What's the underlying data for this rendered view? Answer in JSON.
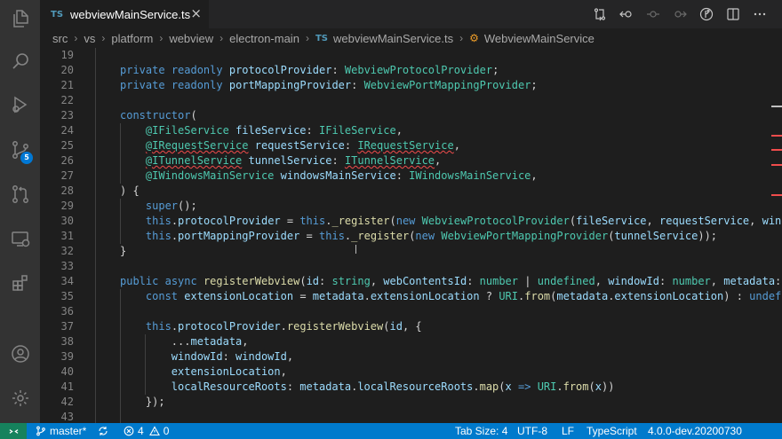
{
  "tab": {
    "language_badge": "TS",
    "file_name": "webviewMainService.ts",
    "close_glyph": "×"
  },
  "toolbar_icons": [
    "compare-changes-icon",
    "go-back-icon",
    "dot-icon",
    "go-forward-icon",
    "source-control-icon",
    "split-editor-icon",
    "more-actions-icon"
  ],
  "breadcrumb": {
    "parts": [
      "src",
      "vs",
      "platform",
      "webview",
      "electron-main"
    ],
    "file_badge": "TS",
    "file": "webviewMainService.ts",
    "symbol": "WebviewMainService"
  },
  "activity_bar": {
    "items": [
      "explorer",
      "search",
      "run-and-debug",
      "source-control",
      "pull-requests",
      "remote-explorer",
      "extensions",
      "accounts",
      "manage"
    ],
    "source_control_badge": "5"
  },
  "editor": {
    "lines": [
      {
        "n": "19",
        "indent": 1,
        "html": ""
      },
      {
        "n": "20",
        "indent": 1,
        "html": "<span class=\"kw\">private</span> <span class=\"kw\">readonly</span> <span class=\"va\">protocolProvider</span>: <span class=\"ty\">WebviewProtocolProvider</span>;"
      },
      {
        "n": "21",
        "indent": 1,
        "html": "<span class=\"kw\">private</span> <span class=\"kw\">readonly</span> <span class=\"va\">portMappingProvider</span>: <span class=\"ty\">WebviewPortMappingProvider</span>;"
      },
      {
        "n": "22",
        "indent": 1,
        "html": ""
      },
      {
        "n": "23",
        "indent": 1,
        "html": "<span class=\"kw\">constructor</span>("
      },
      {
        "n": "24",
        "indent": 2,
        "html": "    <span class=\"ty\">@IFileService</span> <span class=\"va\">fileService</span>: <span class=\"ty\">IFileService</span>,"
      },
      {
        "n": "25",
        "indent": 2,
        "html": "    <span class=\"ty squig\">@IRequestService</span> <span class=\"va\">requestService</span>: <span class=\"ty squig\">IRequestService</span>,"
      },
      {
        "n": "26",
        "indent": 2,
        "html": "    <span class=\"ty squig\">@ITunnelService</span> <span class=\"va\">tunnelService</span>: <span class=\"ty squig\">ITunnelService</span>,"
      },
      {
        "n": "27",
        "indent": 2,
        "html": "    <span class=\"ty\">@IWindowsMainService</span> <span class=\"va\">windowsMainService</span>: <span class=\"ty\">IWindowsMainService</span>,"
      },
      {
        "n": "28",
        "indent": 1,
        "html": ") {"
      },
      {
        "n": "29",
        "indent": 2,
        "html": "    <span class=\"kw\">super</span>();"
      },
      {
        "n": "30",
        "indent": 2,
        "html": "    <span class=\"kw\">this</span>.<span class=\"va\">protocolProvider</span> = <span class=\"kw\">this</span>.<span class=\"fn\">_register</span>(<span class=\"kw\">new</span> <span class=\"ty\">WebviewProtocolProvider</span>(<span class=\"va\">fileService</span>, <span class=\"va\">requestService</span>, <span class=\"va\">windowsMa</span>"
      },
      {
        "n": "31",
        "indent": 2,
        "html": "    <span class=\"kw\">this</span>.<span class=\"va\">portMappingProvider</span> = <span class=\"kw\">this</span>.<span class=\"fn\">_register</span>(<span class=\"kw\">new</span> <span class=\"ty\">WebviewPortMappingProvider</span>(<span class=\"va\">tunnelService</span>));"
      },
      {
        "n": "32",
        "indent": 1,
        "html": "}"
      },
      {
        "n": "33",
        "indent": 1,
        "html": ""
      },
      {
        "n": "34",
        "indent": 1,
        "html": "<span class=\"kw\">public</span> <span class=\"kw\">async</span> <span class=\"fn\">registerWebview</span>(<span class=\"va\">id</span>: <span class=\"ty\">string</span>, <span class=\"va\">webContentsId</span>: <span class=\"ty\">number</span> | <span class=\"ty\">undefined</span>, <span class=\"va\">windowId</span>: <span class=\"ty\">number</span>, <span class=\"va\">metadata</span>: <span class=\"ty\">Regis</span>"
      },
      {
        "n": "35",
        "indent": 2,
        "html": "    <span class=\"kw\">const</span> <span class=\"va\">extensionLocation</span> = <span class=\"va\">metadata</span>.<span class=\"va\">extensionLocation</span> ? <span class=\"ty\">URI</span>.<span class=\"fn\">from</span>(<span class=\"va\">metadata</span>.<span class=\"va\">extensionLocation</span>) : <span class=\"kw\">undefined</span>;"
      },
      {
        "n": "36",
        "indent": 2,
        "html": ""
      },
      {
        "n": "37",
        "indent": 2,
        "html": "    <span class=\"kw\">this</span>.<span class=\"va\">protocolProvider</span>.<span class=\"fn\">registerWebview</span>(<span class=\"va\">id</span>, {"
      },
      {
        "n": "38",
        "indent": 3,
        "html": "        ...<span class=\"va\">metadata</span>,"
      },
      {
        "n": "39",
        "indent": 3,
        "html": "        <span class=\"va\">windowId</span>: <span class=\"va\">windowId</span>,"
      },
      {
        "n": "40",
        "indent": 3,
        "html": "        <span class=\"va\">extensionLocation</span>,"
      },
      {
        "n": "41",
        "indent": 3,
        "html": "        <span class=\"va\">localResourceRoots</span>: <span class=\"va\">metadata</span>.<span class=\"va\">localResourceRoots</span>.<span class=\"fn\">map</span>(<span class=\"va\">x</span> <span class=\"kw\">=&gt;</span> <span class=\"ty\">URI</span>.<span class=\"fn\">from</span>(<span class=\"va\">x</span>))"
      },
      {
        "n": "42",
        "indent": 2,
        "html": "    });"
      },
      {
        "n": "43",
        "indent": 2,
        "html": ""
      }
    ]
  },
  "statusbar": {
    "branch": "master*",
    "errors": "4",
    "warnings": "0",
    "tab_size": "Tab Size: 4",
    "encoding": "UTF-8",
    "eol": "LF",
    "language": "TypeScript",
    "version": "4.0.0-dev.20200730"
  },
  "colors": {
    "status_bar": "#007acc",
    "remote_indicator": "#16825d",
    "editor_bg": "#1e1e1e",
    "activity_bar": "#333333"
  }
}
